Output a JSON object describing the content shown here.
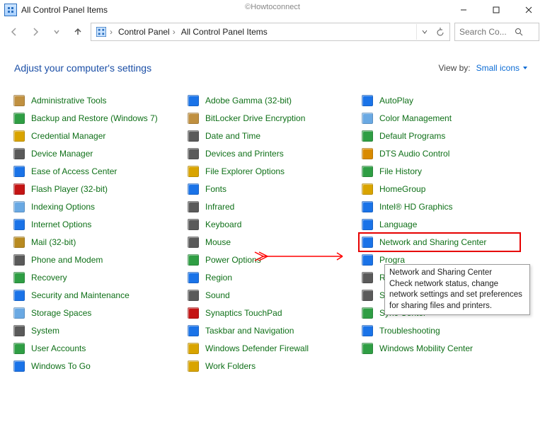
{
  "window": {
    "title": "All Control Panel Items",
    "watermark": "©Howtoconnect"
  },
  "breadcrumb": {
    "root_icon": "control-panel",
    "items": [
      "Control Panel",
      "All Control Panel Items"
    ]
  },
  "search": {
    "placeholder": "Search Co..."
  },
  "header": {
    "title": "Adjust your computer's settings",
    "viewby_label": "View by:",
    "viewby_value": "Small icons"
  },
  "items_col1": [
    {
      "icon": "admintools",
      "label": "Administrative Tools"
    },
    {
      "icon": "backup",
      "label": "Backup and Restore (Windows 7)"
    },
    {
      "icon": "credential",
      "label": "Credential Manager"
    },
    {
      "icon": "device",
      "label": "Device Manager"
    },
    {
      "icon": "ease",
      "label": "Ease of Access Center"
    },
    {
      "icon": "flash",
      "label": "Flash Player (32-bit)"
    },
    {
      "icon": "indexing",
      "label": "Indexing Options"
    },
    {
      "icon": "internet",
      "label": "Internet Options"
    },
    {
      "icon": "mail",
      "label": "Mail (32-bit)"
    },
    {
      "icon": "phone",
      "label": "Phone and Modem"
    },
    {
      "icon": "recovery",
      "label": "Recovery"
    },
    {
      "icon": "security",
      "label": "Security and Maintenance"
    },
    {
      "icon": "storage",
      "label": "Storage Spaces"
    },
    {
      "icon": "system",
      "label": "System"
    },
    {
      "icon": "user",
      "label": "User Accounts"
    },
    {
      "icon": "wintogo",
      "label": "Windows To Go"
    }
  ],
  "items_col2": [
    {
      "icon": "gamma",
      "label": "Adobe Gamma (32-bit)"
    },
    {
      "icon": "bitlocker",
      "label": "BitLocker Drive Encryption"
    },
    {
      "icon": "datetime",
      "label": "Date and Time"
    },
    {
      "icon": "devices",
      "label": "Devices and Printers"
    },
    {
      "icon": "explorer",
      "label": "File Explorer Options"
    },
    {
      "icon": "fonts",
      "label": "Fonts"
    },
    {
      "icon": "infrared",
      "label": "Infrared"
    },
    {
      "icon": "keyboard",
      "label": "Keyboard"
    },
    {
      "icon": "mouse",
      "label": "Mouse"
    },
    {
      "icon": "power",
      "label": "Power Options"
    },
    {
      "icon": "region",
      "label": "Region"
    },
    {
      "icon": "sound",
      "label": "Sound"
    },
    {
      "icon": "touchpad",
      "label": "Synaptics TouchPad"
    },
    {
      "icon": "taskbar",
      "label": "Taskbar and Navigation"
    },
    {
      "icon": "firewall",
      "label": "Windows Defender Firewall"
    },
    {
      "icon": "workfolders",
      "label": "Work Folders"
    }
  ],
  "items_col3": [
    {
      "icon": "autoplay",
      "label": "AutoPlay"
    },
    {
      "icon": "color",
      "label": "Color Management"
    },
    {
      "icon": "default",
      "label": "Default Programs"
    },
    {
      "icon": "dts",
      "label": "DTS Audio Control"
    },
    {
      "icon": "filehist",
      "label": "File History"
    },
    {
      "icon": "homegroup",
      "label": "HomeGroup"
    },
    {
      "icon": "intel",
      "label": "Intel® HD Graphics"
    },
    {
      "icon": "language",
      "label": "Language"
    },
    {
      "icon": "network",
      "label": "Network and Sharing Center",
      "highlighted": true
    },
    {
      "icon": "programs",
      "label": "Progra"
    },
    {
      "icon": "remote",
      "label": "Remot"
    },
    {
      "icon": "speech",
      "label": "Speech"
    },
    {
      "icon": "sync",
      "label": "Sync Center"
    },
    {
      "icon": "trouble",
      "label": "Troubleshooting"
    },
    {
      "icon": "mobility",
      "label": "Windows Mobility Center"
    }
  ],
  "tooltip": {
    "title": "Network and Sharing Center",
    "body": "Check network status, change network settings and set preferences for sharing files and printers."
  },
  "icon_colors": {
    "admintools": "#c09040",
    "backup": "#2f9e44",
    "credential": "#d9a400",
    "device": "#5a5a5a",
    "ease": "#1a73e8",
    "flash": "#c41414",
    "indexing": "#6aa9e3",
    "internet": "#1a73e8",
    "mail": "#b88a20",
    "phone": "#5a5a5a",
    "recovery": "#2f9e44",
    "security": "#1a73e8",
    "storage": "#6aa9e3",
    "system": "#5a5a5a",
    "user": "#2f9e44",
    "wintogo": "#1a73e8",
    "gamma": "#1a73e8",
    "bitlocker": "#c09040",
    "datetime": "#5a5a5a",
    "devices": "#5a5a5a",
    "explorer": "#d9a400",
    "fonts": "#1a73e8",
    "infrared": "#5a5a5a",
    "keyboard": "#5a5a5a",
    "mouse": "#5a5a5a",
    "power": "#2f9e44",
    "region": "#1a73e8",
    "sound": "#5a5a5a",
    "touchpad": "#c41414",
    "taskbar": "#1a73e8",
    "firewall": "#d9a400",
    "workfolders": "#d9a400",
    "autoplay": "#1a73e8",
    "color": "#6aa9e3",
    "default": "#2f9e44",
    "dts": "#d98a00",
    "filehist": "#2f9e44",
    "homegroup": "#d9a400",
    "intel": "#1a73e8",
    "language": "#1a73e8",
    "network": "#1a73e8",
    "programs": "#1a73e8",
    "remote": "#5a5a5a",
    "speech": "#5a5a5a",
    "sync": "#2f9e44",
    "trouble": "#1a73e8",
    "mobility": "#2f9e44"
  }
}
